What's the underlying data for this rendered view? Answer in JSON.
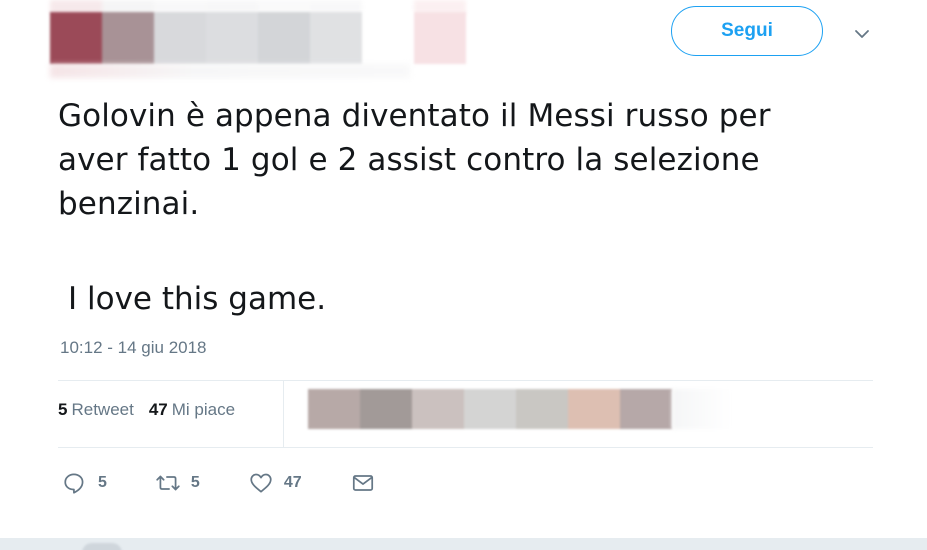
{
  "header": {
    "follow_label": "Segui",
    "caret_icon": "chevron-down-icon",
    "name_pixels": [
      "#9b4a58",
      "#a89296",
      "#d8d9dc",
      "#dcdde0",
      "#d3d5d8",
      "#e0e1e3",
      "#ffffff",
      "#f7e1e4"
    ],
    "top_strip_pixels": [
      "#f0d8db",
      "#eeeeef",
      "#f4f4f5",
      "#f2f2f3",
      "#f6f6f7",
      "#f4f4f5",
      "#ffffff",
      "#f9e4e6"
    ]
  },
  "tweet": {
    "text": "Golovin è appena diventato il Messi russo per\naver fatto 1 gol e 2 assist contro la selezione\nbenzinai.",
    "text_line_2": "I love this game.",
    "timestamp": "10:12 - 14 giu 2018"
  },
  "stats": {
    "retweets_count": "5",
    "retweets_label": "Retweet",
    "likes_count": "47",
    "likes_label": "Mi piace",
    "liker_avatar_pixels": [
      "#b7a9a7",
      "#a29a98",
      "#cbc1bf",
      "#d4d4d3",
      "#c9c7c3",
      "#ddbfb2",
      "#b6a8a8"
    ]
  },
  "actions": {
    "reply_icon": "reply-icon",
    "reply_count": "5",
    "retweet_icon": "retweet-icon",
    "retweet_count": "5",
    "like_icon": "heart-icon",
    "like_count": "47",
    "dm_icon": "envelope-icon"
  },
  "colors": {
    "accent": "#1da1f2",
    "text": "#14171a",
    "muted": "#657786",
    "divider": "#e6ecf0"
  }
}
